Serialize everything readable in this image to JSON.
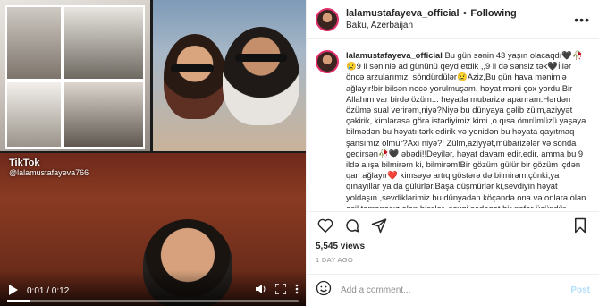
{
  "media": {
    "tiktok_label": "TikTok",
    "tiktok_handle": "@lalamustafayeva766",
    "time": "0:01 / 0:12",
    "progress": 0.08,
    "icons": [
      "play-icon",
      "volume-icon",
      "fullscreen-icon",
      "more-vert-icon"
    ]
  },
  "header": {
    "username": "lalamustafayeva_official",
    "separator": "•",
    "follow_label": "Following",
    "location": "Baku, Azerbaijan",
    "more_label": "•••"
  },
  "post": {
    "username": "lalamustafayeva_official",
    "caption": "Bu gün sənin 43 yaşın olacaqdı🖤🥀😢9 il səninlə ad gününü qeyd etdik ,,9 il də sənsiz tək🖤İllər öncə arzularımızı söndürdülər😢Aziz,Bu gün hava mənimlə ağlayır!bir bilsən necə yorulmuşam, həyat məni çox yordu!Bir Allahım var birdə özüm... heyatla mubarizə aparıram.Hərdən özümə sual verirəm,niyə?Niyə bu dünyaya gəlib zülm,aziyyət çəkirik, kimlərəsə görə istədiyimiz kimi ,o qısa ömrümüzü yaşaya bilmədən bu həyatı tərk edirik və yenidən bu həyata qayıtmaq şansımız olmur?Axı niyə?! Zülm,aziyyət,mübarizələr və sonda gedirsən🥀🖤 əbədi!!Deyilər, həyat davam edir,edir, amma bu 9 ildə alışa bilmirəm ki, bilmirəm!Bir gözüm gülür bir gözüm içdən qan ağlayır❤️ kimsəyə artıq göstərə də bilmirəm,çünki,ya qınayıllar ya da gülürlər.Başa düşmürlər ki,sevdiyin həyat yoldaşın ,sevdiklərimiz bu dünyadan köçəndə ona və onlara olan əsil təmənasız olan hisslər, sevgi,sədaqət bir nəfər üçündür.."
  },
  "stats": {
    "views": "5,545 views",
    "ago": "1 DAY AGO"
  },
  "comment": {
    "placeholder": "Add a comment...",
    "post_label": "Post"
  }
}
